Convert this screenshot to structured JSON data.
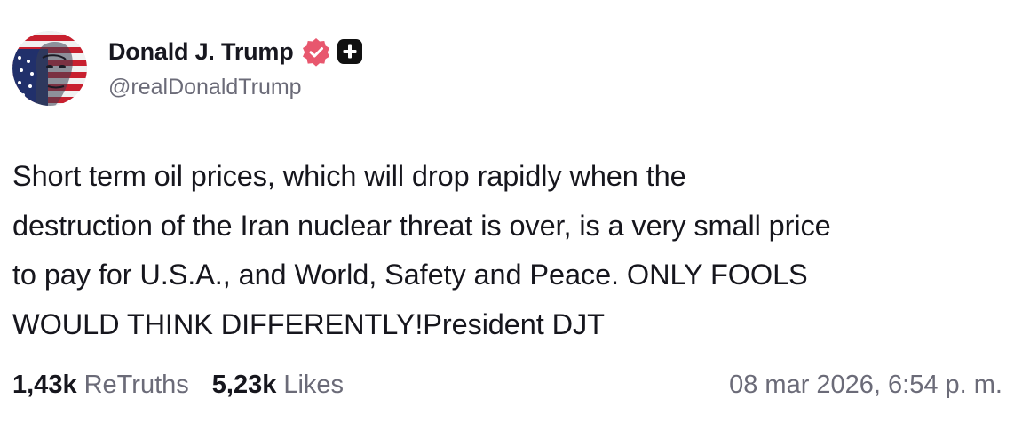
{
  "author": {
    "display_name": "Donald J. Trump",
    "handle": "@realDonaldTrump",
    "avatar_icon": "flag-portrait-avatar",
    "verified_icon": "verified-badge-icon",
    "plus_icon": "plus-badge-icon"
  },
  "post": {
    "lines": [
      "Short term oil prices, which will drop rapidly when the",
      "destruction of the Iran nuclear threat is over, is a very small price",
      "to pay for U.S.A., and World, Safety and Peace. ONLY FOOLS",
      "WOULD THINK DIFFERENTLY!President DJT"
    ]
  },
  "stats": {
    "retruths_count": "1,43k",
    "retruths_label": "ReTruths",
    "likes_count": "5,23k",
    "likes_label": "Likes"
  },
  "timestamp": "08 mar 2026, 6:54 p. m.",
  "colors": {
    "text": "#16161d",
    "muted": "#6b6b78",
    "verified_badge": "#e8576e",
    "plus_badge": "#111111"
  }
}
